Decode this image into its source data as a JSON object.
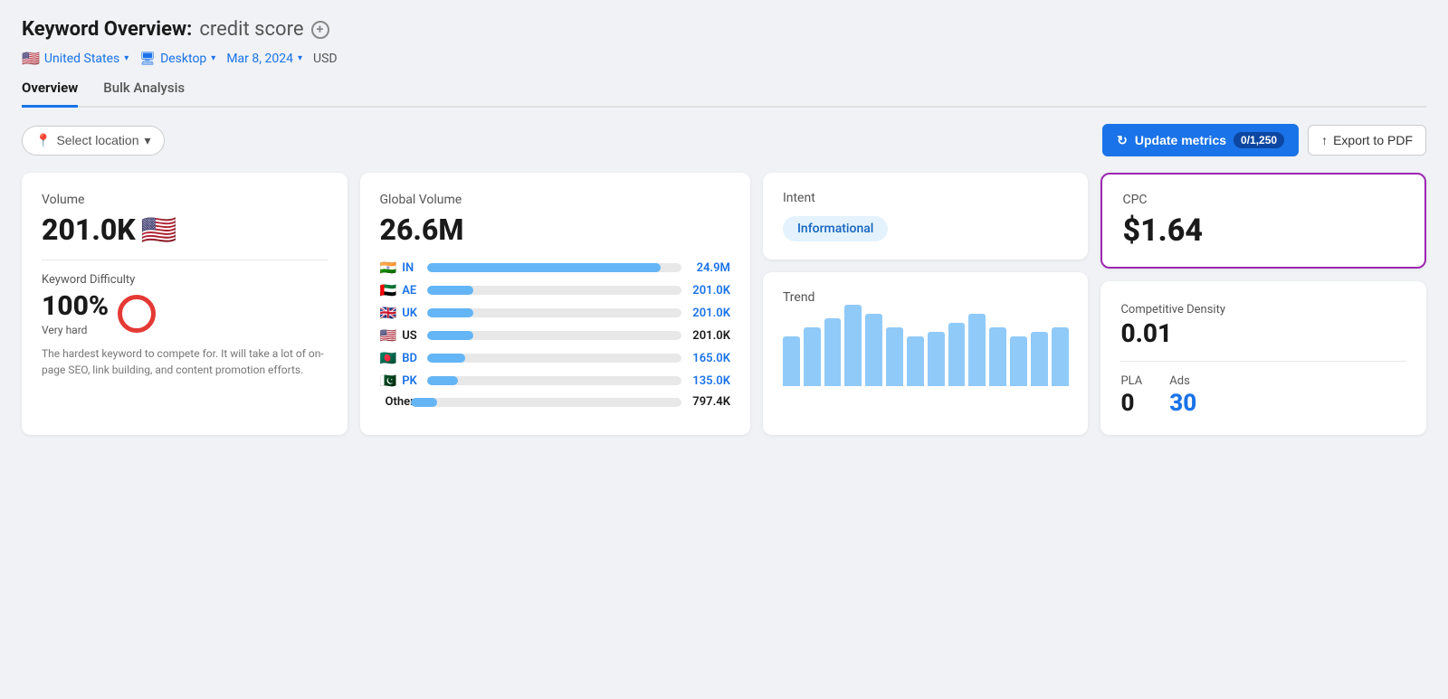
{
  "page": {
    "title_prefix": "Keyword Overview:",
    "title_keyword": "credit score",
    "add_icon": "+"
  },
  "toolbar": {
    "location": "United States",
    "location_flag": "🇺🇸",
    "device_icon": "desktop",
    "device": "Desktop",
    "date": "Mar 8, 2024",
    "currency": "USD"
  },
  "tabs": [
    {
      "label": "Overview",
      "active": true
    },
    {
      "label": "Bulk Analysis",
      "active": false
    }
  ],
  "controls": {
    "select_location_label": "Select location",
    "update_metrics_label": "Update metrics",
    "update_metrics_count": "0/1,250",
    "export_label": "Export to PDF"
  },
  "volume_card": {
    "label": "Volume",
    "value": "201.0K",
    "flag": "🇺🇸",
    "difficulty_label": "Keyword Difficulty",
    "difficulty_value": "100%",
    "difficulty_sublabel": "Very hard",
    "difficulty_desc": "The hardest keyword to compete for. It will take a lot of on-page SEO, link building, and content promotion efforts."
  },
  "global_volume_card": {
    "label": "Global Volume",
    "value": "26.6M",
    "countries": [
      {
        "flag": "🇮🇳",
        "code": "IN",
        "bar_pct": 92,
        "value": "24.9M",
        "blue": true
      },
      {
        "flag": "🇦🇪",
        "code": "AE",
        "bar_pct": 18,
        "value": "201.0K",
        "blue": true
      },
      {
        "flag": "🇬🇧",
        "code": "UK",
        "bar_pct": 18,
        "value": "201.0K",
        "blue": true
      },
      {
        "flag": "🇺🇸",
        "code": "US",
        "bar_pct": 18,
        "value": "201.0K",
        "blue": false
      },
      {
        "flag": "🇧🇩",
        "code": "BD",
        "bar_pct": 15,
        "value": "165.0K",
        "blue": true
      },
      {
        "flag": "🇵🇰",
        "code": "PK",
        "bar_pct": 12,
        "value": "135.0K",
        "blue": true
      },
      {
        "flag": "",
        "code": "Other",
        "bar_pct": 10,
        "value": "797.4K",
        "blue": false
      }
    ]
  },
  "intent_card": {
    "label": "Intent",
    "badge": "Informational"
  },
  "trend_card": {
    "label": "Trend",
    "bars": [
      55,
      65,
      75,
      90,
      80,
      65,
      55,
      60,
      70,
      80,
      65,
      55,
      60,
      65
    ]
  },
  "cpc_card": {
    "label": "CPC",
    "value": "$1.64"
  },
  "comp_density_card": {
    "label": "Competitive Density",
    "value": "0.01",
    "pla_label": "PLA",
    "pla_value": "0",
    "ads_label": "Ads",
    "ads_value": "30"
  },
  "colors": {
    "blue": "#1a73e8",
    "purple": "#9c27b0",
    "red": "#e53935",
    "bar_blue": "#64b5f6",
    "trend_bar": "#90caf9"
  }
}
